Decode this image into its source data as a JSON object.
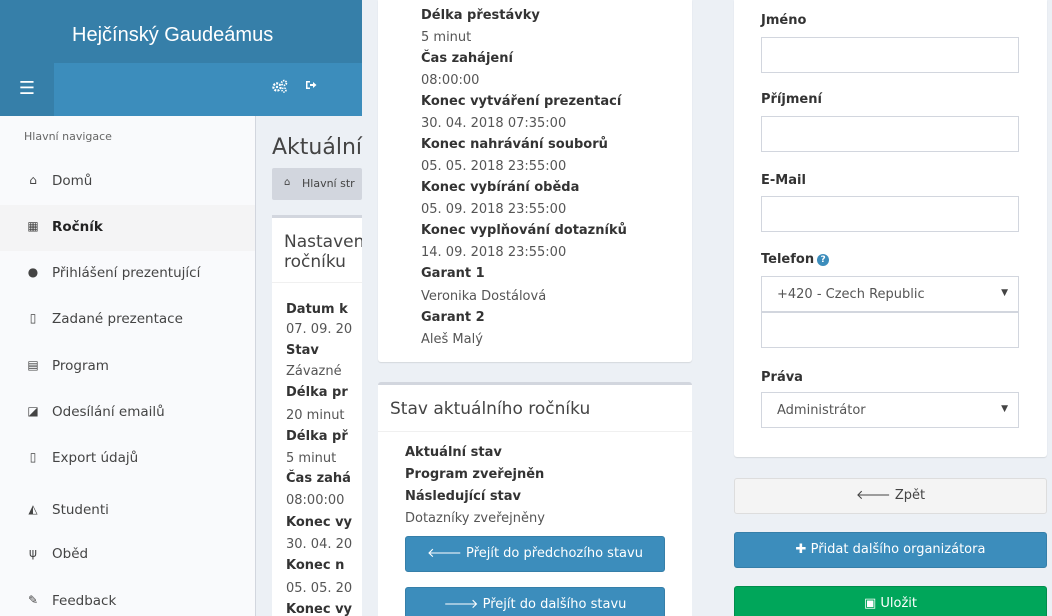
{
  "app": {
    "title": "Hejčínský Gaudeámus"
  },
  "topnav": {
    "menu_icon": "☰",
    "settings_icon": "gears-icon",
    "signout_icon": "sign-out-icon"
  },
  "sidebar": {
    "header": "Hlavní navigace",
    "items": [
      {
        "label": "Domů",
        "icon": "home-icon",
        "glyph": "⌂"
      },
      {
        "label": "Ročník",
        "icon": "calendar-icon",
        "glyph": "▦"
      },
      {
        "label": "Přihlášení prezentující",
        "icon": "user-icon",
        "glyph": "●"
      },
      {
        "label": "Zadané prezentace",
        "icon": "file-powerpoint-icon",
        "glyph": "▯"
      },
      {
        "label": "Program",
        "icon": "table-icon",
        "glyph": "▤"
      },
      {
        "label": "Odesílání emailů",
        "icon": "share-square-icon",
        "glyph": "◪"
      },
      {
        "label": "Export údajů",
        "icon": "file-pdf-icon",
        "glyph": "▯"
      },
      {
        "label": "Studenti",
        "icon": "graduation-cap-icon",
        "glyph": "◭"
      },
      {
        "label": "Oběd",
        "icon": "cutlery-icon",
        "glyph": "ψ"
      },
      {
        "label": "Feedback",
        "icon": "edit-icon",
        "glyph": "✎"
      }
    ]
  },
  "main": {
    "title": "Aktuální",
    "breadcrumb": "Hlavní str",
    "settings_box": {
      "title_line1": "Nastaven",
      "title_line2": "ročníku",
      "rows": [
        {
          "label": "Datum k",
          "value": "07. 09. 20"
        },
        {
          "label": "Stav",
          "value": "Závazné"
        },
        {
          "label": "Délka pr",
          "value": "20 minut"
        },
        {
          "label": "Délka př",
          "value": "5 minut"
        },
        {
          "label": "Čas zahá",
          "value": "08:00:00"
        },
        {
          "label": "Konec vy",
          "value": "30. 04. 20"
        },
        {
          "label": "Konec n",
          "value": "05. 05. 20"
        },
        {
          "label": "Konec vy",
          "value": ""
        }
      ]
    }
  },
  "details": {
    "rows": [
      {
        "label": "Délka přestávky",
        "value": "5 minut"
      },
      {
        "label": "Čas zahájení",
        "value": "08:00:00"
      },
      {
        "label": "Konec vytváření prezentací",
        "value": "30. 04. 2018 07:35:00"
      },
      {
        "label": "Konec nahrávání souborů",
        "value": "05. 05. 2018 23:55:00"
      },
      {
        "label": "Konec vybírání oběda",
        "value": "05. 09. 2018 23:55:00"
      },
      {
        "label": "Konec vyplňování dotazníků",
        "value": "14. 09. 2018 23:55:00"
      },
      {
        "label": "Garant 1",
        "value": "Veronika Dostálová"
      },
      {
        "label": "Garant 2",
        "value": "Aleš Malý"
      }
    ]
  },
  "status_box": {
    "title": "Stav aktuálního ročníku",
    "current_label": "Aktuální stav",
    "current_value": "Program zveřejněn",
    "next_label": "Následující stav",
    "next_value": "Dotazníky zveřejněny",
    "prev_button": "Přejít do předchozího stavu",
    "next_button": "Přejít do dalšího stavu"
  },
  "form": {
    "first_name_label": "Jméno",
    "first_name_value": "",
    "last_name_label": "Příjmení",
    "last_name_value": "",
    "email_label": "E-Mail",
    "email_value": "",
    "phone_label": "Telefon",
    "phone_country": "+420 - Czech Republic",
    "phone_value": "",
    "rights_label": "Práva",
    "rights_value": "Administrátor",
    "back_button": "Zpět",
    "add_button": "Přidat dalšího organizátora",
    "save_button": "Uložit"
  },
  "colors": {
    "header": "#367fa9",
    "nav": "#3c8dbc",
    "primary": "#3c8dbc",
    "success": "#00a65a"
  }
}
